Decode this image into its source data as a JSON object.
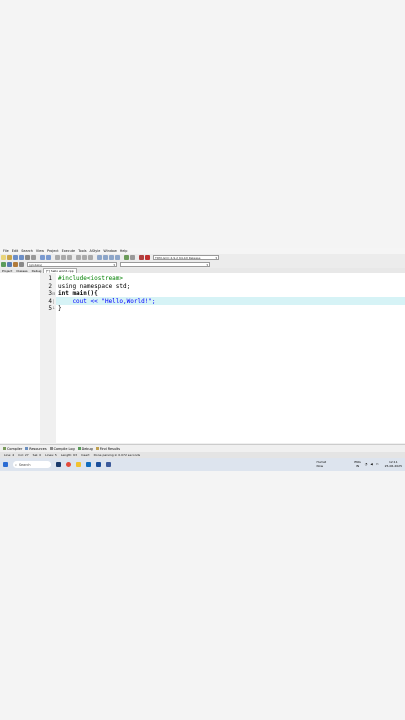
{
  "menu": [
    "File",
    "Edit",
    "Search",
    "View",
    "Project",
    "Execute",
    "Tools",
    "AStyle",
    "Window",
    "Help"
  ],
  "toolbar": {
    "compiler": "TDM-GCC 4.9.2 64-bit Release",
    "globals": "(globals)"
  },
  "panel_tabs": [
    "Project",
    "Classes",
    "Debug"
  ],
  "file_tab": "[*] hello world.cpp",
  "editor": {
    "line_numbers": [
      "1",
      "2",
      "3",
      "4",
      "5"
    ],
    "lines": [
      "#include<iostream>",
      "using namespace std;",
      "int main(){",
      "    cout << \"Hello,World!\";",
      "}"
    ]
  },
  "bottom_tabs": [
    "Compiler",
    "Resources",
    "Compile Log",
    "Debug",
    "Find Results"
  ],
  "status": {
    "line": "Line: 4",
    "col": "Col: 27",
    "sel": "Sel: 0",
    "lines": "Lines: 5",
    "length": "Length: 63",
    "mode": "Insert",
    "msg": "Done parsing in 0.072 seconds"
  },
  "taskbar": {
    "search": "Search",
    "weather": "Humid",
    "weather_sub": "Now",
    "lang": "ENG",
    "lang_sub": "IN",
    "time": "12:11",
    "date": "25-06-2025"
  },
  "colors": {
    "accent": "#d6f3f6",
    "keyword": "#000000",
    "string": "#0000ff",
    "include": "#008000"
  }
}
